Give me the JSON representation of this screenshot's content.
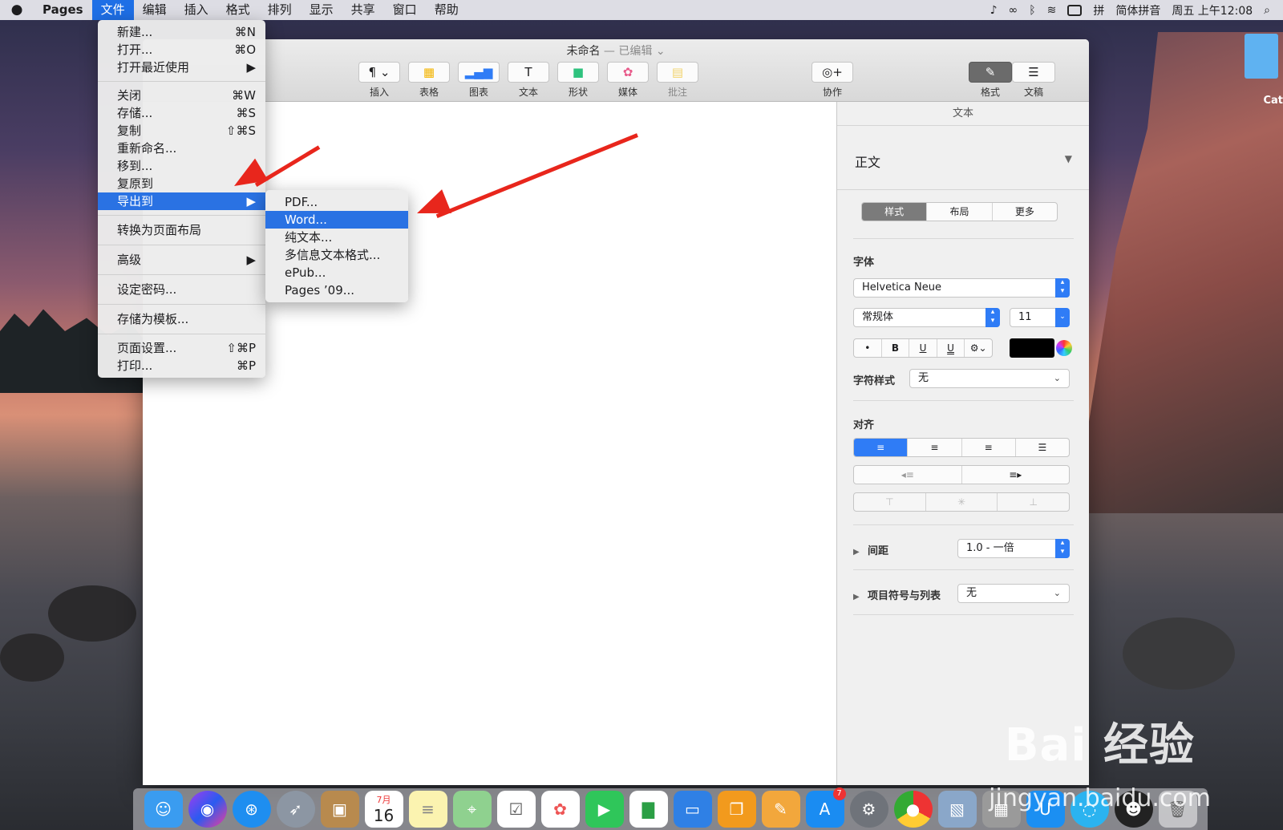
{
  "menubar": {
    "app_name": "Pages",
    "items": [
      "文件",
      "编辑",
      "插入",
      "格式",
      "排列",
      "显示",
      "共享",
      "窗口",
      "帮助"
    ],
    "input_method": "简体拼音",
    "clock": "周五 上午12:08"
  },
  "window": {
    "title": "未命名",
    "title_suffix": "— 已编辑"
  },
  "toolbar": {
    "insert": "插入",
    "table": "表格",
    "chart": "图表",
    "text": "文本",
    "shape": "形状",
    "media": "媒体",
    "comment": "批注",
    "collaborate": "协作",
    "format": "格式",
    "document": "文稿"
  },
  "file_menu": {
    "new": "新建...",
    "new_sc": "⌘N",
    "open": "打开...",
    "open_sc": "⌘O",
    "recent": "打开最近使用",
    "close": "关闭",
    "close_sc": "⌘W",
    "save": "存储...",
    "save_sc": "⌘S",
    "duplicate": "复制",
    "duplicate_sc": "⇧⌘S",
    "rename": "重新命名...",
    "move": "移到...",
    "revert": "复原到",
    "export": "导出到",
    "convert": "转换为页面布局",
    "advanced": "高级",
    "password": "设定密码...",
    "template": "存储为模板...",
    "page_setup": "页面设置...",
    "page_setup_sc": "⇧⌘P",
    "print": "打印...",
    "print_sc": "⌘P"
  },
  "export_menu": {
    "pdf": "PDF...",
    "word": "Word...",
    "plain": "纯文本...",
    "rtf": "多信息文本格式...",
    "epub": "ePub...",
    "pages09": "Pages ’09..."
  },
  "sidebar": {
    "header": "文本",
    "paragraph_style": "正文",
    "tabs": [
      "样式",
      "布局",
      "更多"
    ],
    "font_label": "字体",
    "font": "Helvetica Neue",
    "typeface": "常规体",
    "size": "11",
    "bold": "B",
    "underline": "U",
    "char_style_label": "字符样式",
    "char_style": "无",
    "align_label": "对齐",
    "spacing_label": "间距",
    "spacing": "1.0 - 一倍",
    "bullets_label": "项目符号与列表",
    "bullets": "无"
  },
  "desktop": {
    "folder_label": "Cat",
    "calendar_month": "7月",
    "calendar_day": "16",
    "appstore_badge": "7"
  },
  "watermark": {
    "brand": "Bai 经验",
    "url": "jingyan.baidu.com"
  },
  "colors": {
    "menu_highlight": "#2a72e3",
    "annotation_arrow": "#e8261c",
    "accent": "#2f7cf6"
  }
}
